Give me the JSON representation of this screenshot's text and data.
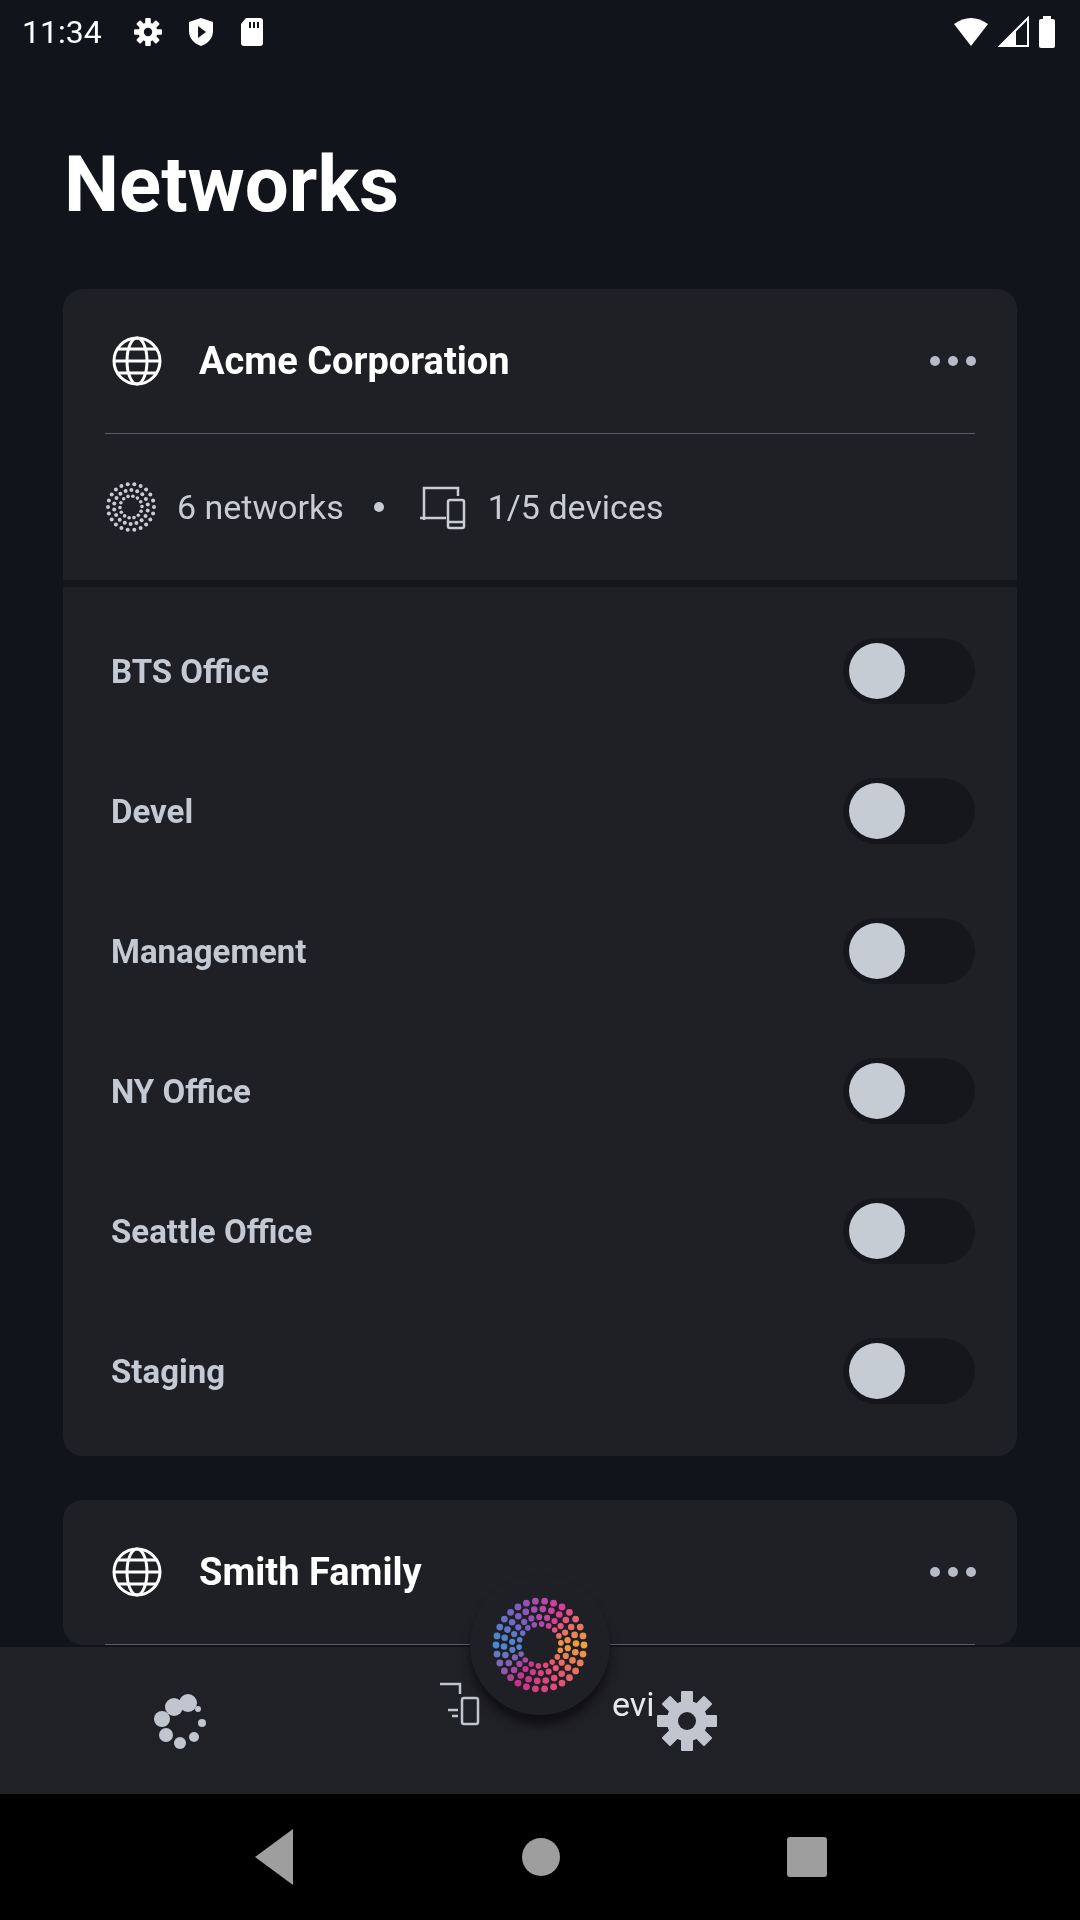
{
  "status_bar": {
    "time": "11:34"
  },
  "title": "Networks",
  "organizations": [
    {
      "name": "Acme Corporation",
      "networks_count": "6 networks",
      "devices_count": "1/5 devices",
      "networks": [
        {
          "name": "BTS Office",
          "on": false
        },
        {
          "name": "Devel",
          "on": false
        },
        {
          "name": "Management",
          "on": false
        },
        {
          "name": "NY Office",
          "on": false
        },
        {
          "name": "Seattle Office",
          "on": false
        },
        {
          "name": "Staging",
          "on": false
        }
      ]
    },
    {
      "name": "Smith Family"
    }
  ],
  "bottom_nav": {
    "devices_label": "evi"
  }
}
